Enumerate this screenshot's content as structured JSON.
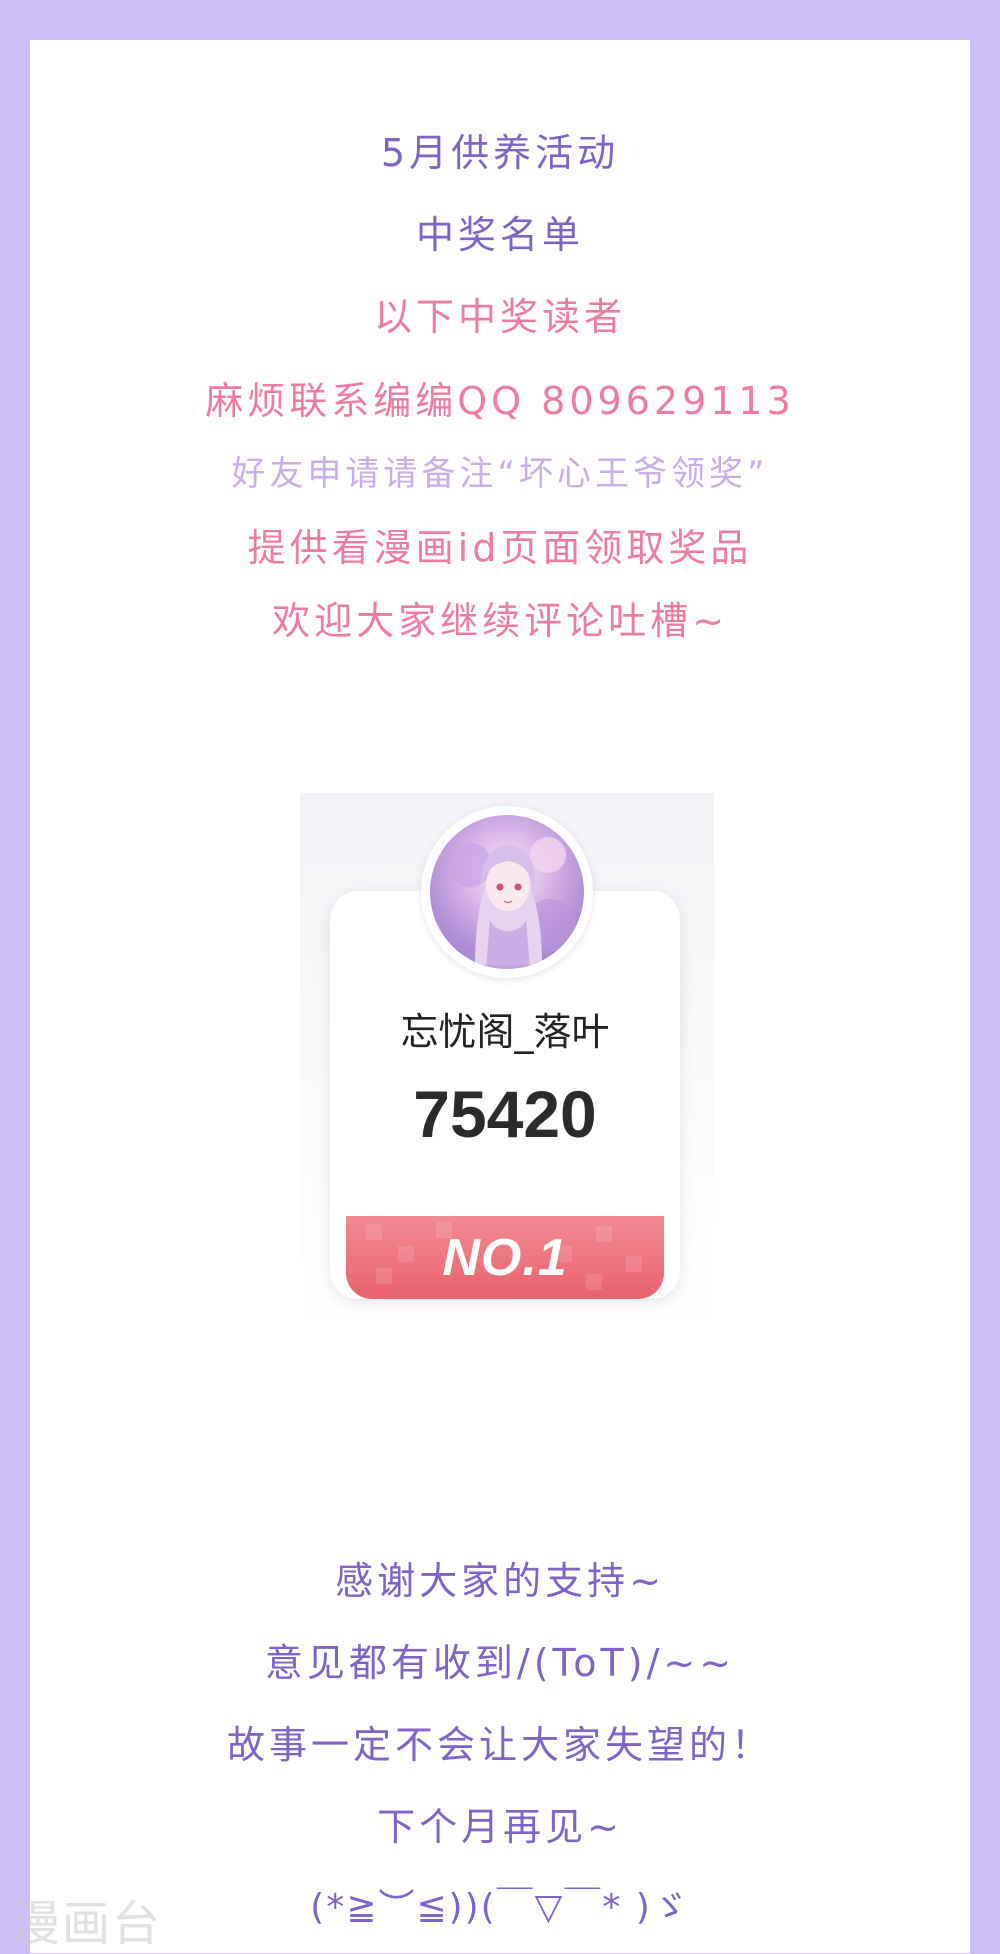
{
  "header_lines": [
    "5月供养活动",
    "中奖名单",
    "以下中奖读者",
    "麻烦联系编编QQ 809629113",
    "好友申请请备注“坏心王爷领奖”",
    "提供看漫画id页面领取奖品",
    "欢迎大家继续评论吐槽~"
  ],
  "winner": {
    "name": "忘忧阁_落叶",
    "score": "75420",
    "rank": "NO.1"
  },
  "footer_lines": [
    "感谢大家的支持~",
    "意见都有收到/(ToT)/~~",
    "故事一定不会让大家失望的！",
    "下个月再见~",
    "(*≧︶≦))(￣▽￣* )ゞ"
  ],
  "watermark": "漫画台",
  "colors": {
    "frame": "#cdbdf7",
    "purple_text": "#7f63c6",
    "pink_text": "#ee7ba2",
    "lilac_text": "#c9aee8",
    "rank_band": "#e9626e"
  }
}
